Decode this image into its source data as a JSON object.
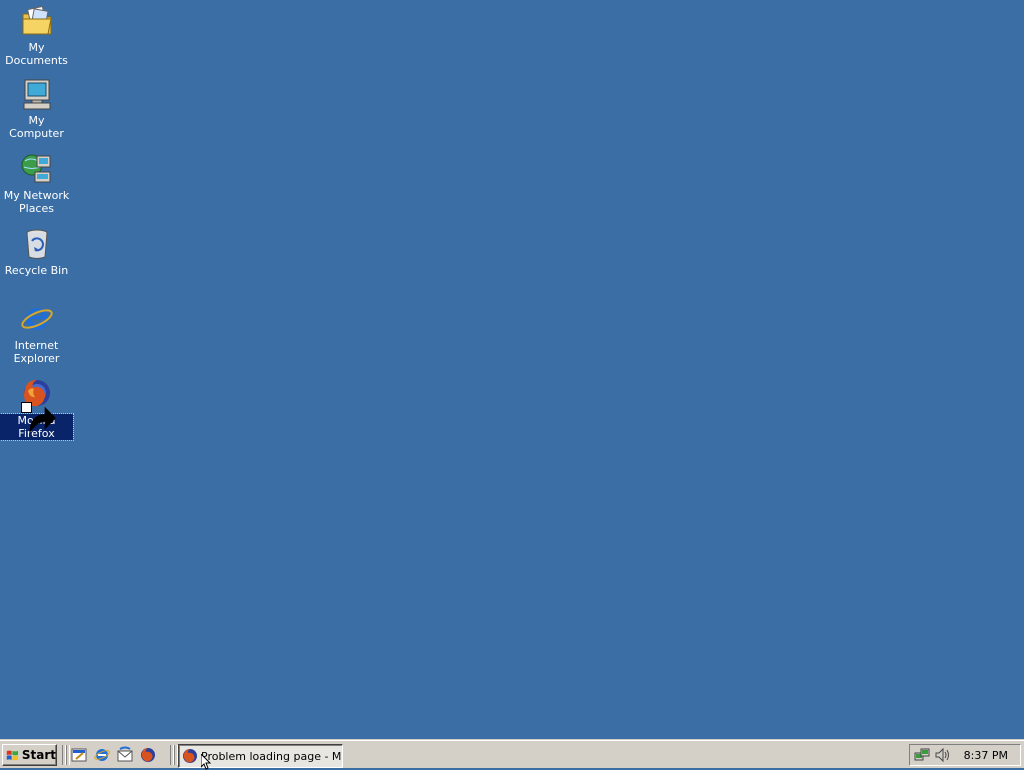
{
  "desktop": {
    "background": "#3a6ea5",
    "icons": [
      {
        "label": "My Documents",
        "icon": "folder-documents-icon"
      },
      {
        "label": "My Computer",
        "icon": "computer-icon"
      },
      {
        "label": "My Network\nPlaces",
        "icon": "network-places-icon"
      },
      {
        "label": "Recycle Bin",
        "icon": "recycle-bin-icon"
      },
      {
        "label": "Internet\nExplorer",
        "icon": "internet-explorer-icon"
      },
      {
        "label": "Mozilla Firefox",
        "icon": "firefox-icon",
        "selected": true,
        "shortcut": true
      }
    ]
  },
  "taskbar": {
    "start_label": "Start",
    "quick_launch": [
      "show-desktop-icon",
      "internet-explorer-icon",
      "outlook-express-icon",
      "firefox-icon"
    ],
    "task_button_label": "Problem loading page - M...",
    "task_button_icon": "firefox-icon",
    "tray_icons": [
      "network-icon",
      "volume-icon"
    ],
    "clock": "8:37 PM"
  }
}
